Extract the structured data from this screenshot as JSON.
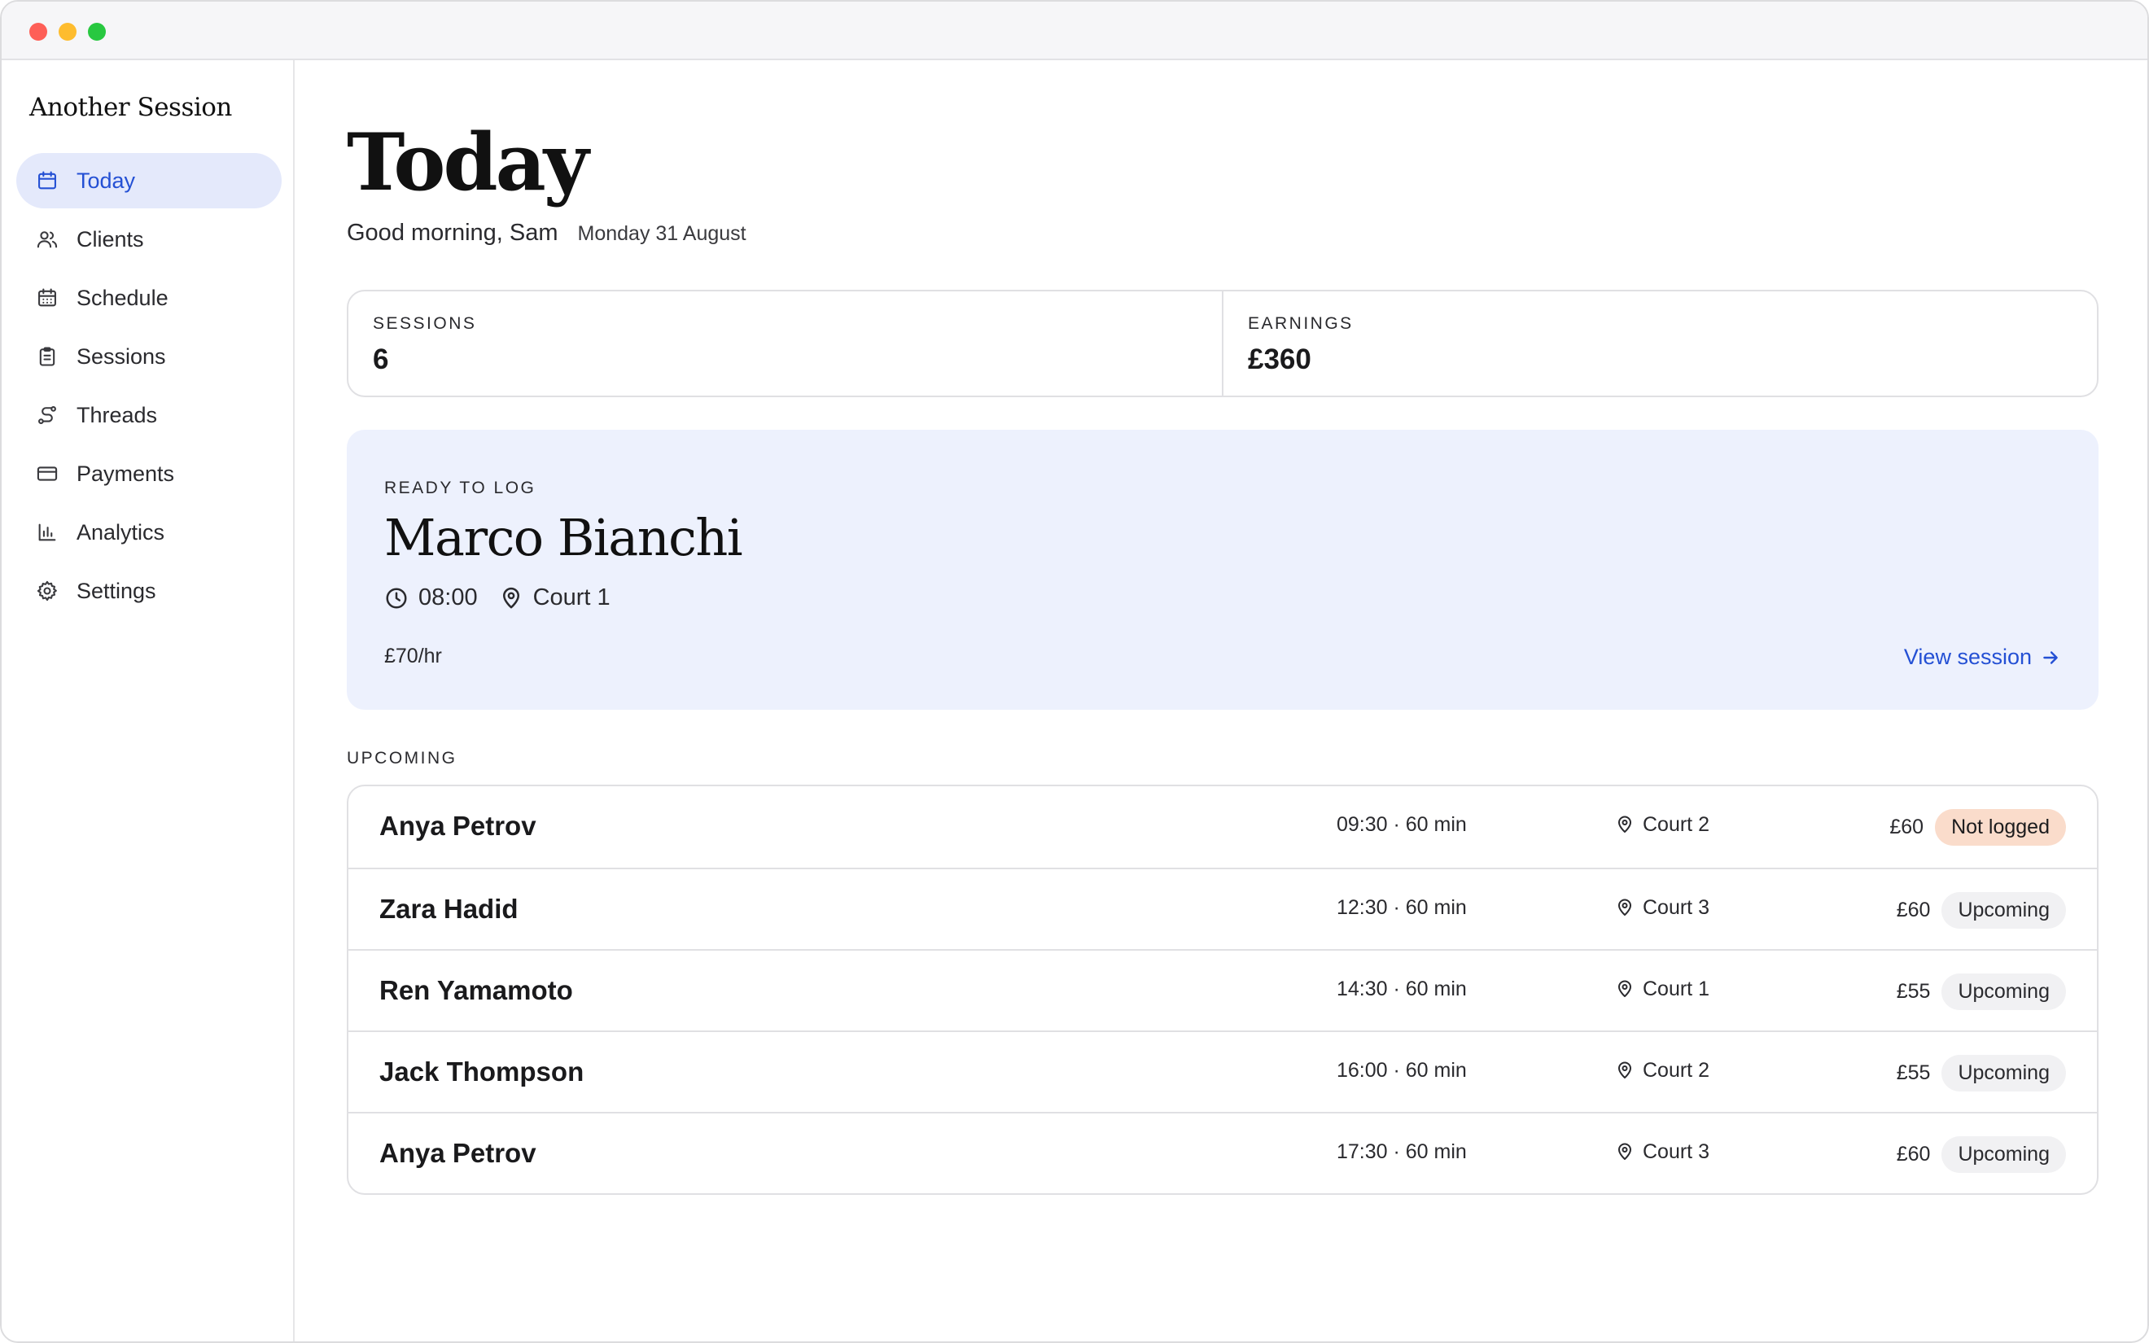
{
  "app": {
    "brand": "Another Session"
  },
  "sidebar": {
    "items": [
      {
        "label": "Today",
        "icon": "calendar-icon",
        "active": true
      },
      {
        "label": "Clients",
        "icon": "users-icon"
      },
      {
        "label": "Schedule",
        "icon": "calendar-grid-icon"
      },
      {
        "label": "Sessions",
        "icon": "clipboard-icon"
      },
      {
        "label": "Threads",
        "icon": "route-icon"
      },
      {
        "label": "Payments",
        "icon": "credit-card-icon"
      },
      {
        "label": "Analytics",
        "icon": "bar-chart-icon"
      },
      {
        "label": "Settings",
        "icon": "gear-icon"
      }
    ]
  },
  "header": {
    "title": "Today",
    "greeting": "Good morning, Sam",
    "date": "Monday 31 August"
  },
  "stats": {
    "sessions": {
      "label": "SESSIONS",
      "value": "6"
    },
    "earnings": {
      "label": "EARNINGS",
      "value": "£360"
    }
  },
  "feature": {
    "eyebrow": "READY TO LOG",
    "client": "Marco Bianchi",
    "time": "08:00",
    "location": "Court 1",
    "rate": "£70/hr",
    "action": "View session"
  },
  "upcoming": {
    "label": "UPCOMING",
    "rows": [
      {
        "client": "Anya Petrov",
        "time": "09:30 · 60 min",
        "location": "Court 2",
        "price": "£60",
        "status": "Not logged",
        "status_color": "#fadccb"
      },
      {
        "client": "Zara Hadid",
        "time": "12:30 · 60 min",
        "location": "Court 3",
        "price": "£60",
        "status": "Upcoming",
        "status_color": "#f1f1f3"
      },
      {
        "client": "Ren Yamamoto",
        "time": "14:30 · 60 min",
        "location": "Court 1",
        "price": "£55",
        "status": "Upcoming",
        "status_color": "#f1f1f3"
      },
      {
        "client": "Jack Thompson",
        "time": "16:00 · 60 min",
        "location": "Court 2",
        "price": "£55",
        "status": "Upcoming",
        "status_color": "#f1f1f3"
      },
      {
        "client": "Anya Petrov",
        "time": "17:30 · 60 min",
        "location": "Court 3",
        "price": "£60",
        "status": "Upcoming",
        "status_color": "#f1f1f3"
      }
    ]
  },
  "colors": {
    "accent": "#2450d4",
    "active_bg": "#e4e9fb",
    "feature_bg": "#edf1fd"
  }
}
